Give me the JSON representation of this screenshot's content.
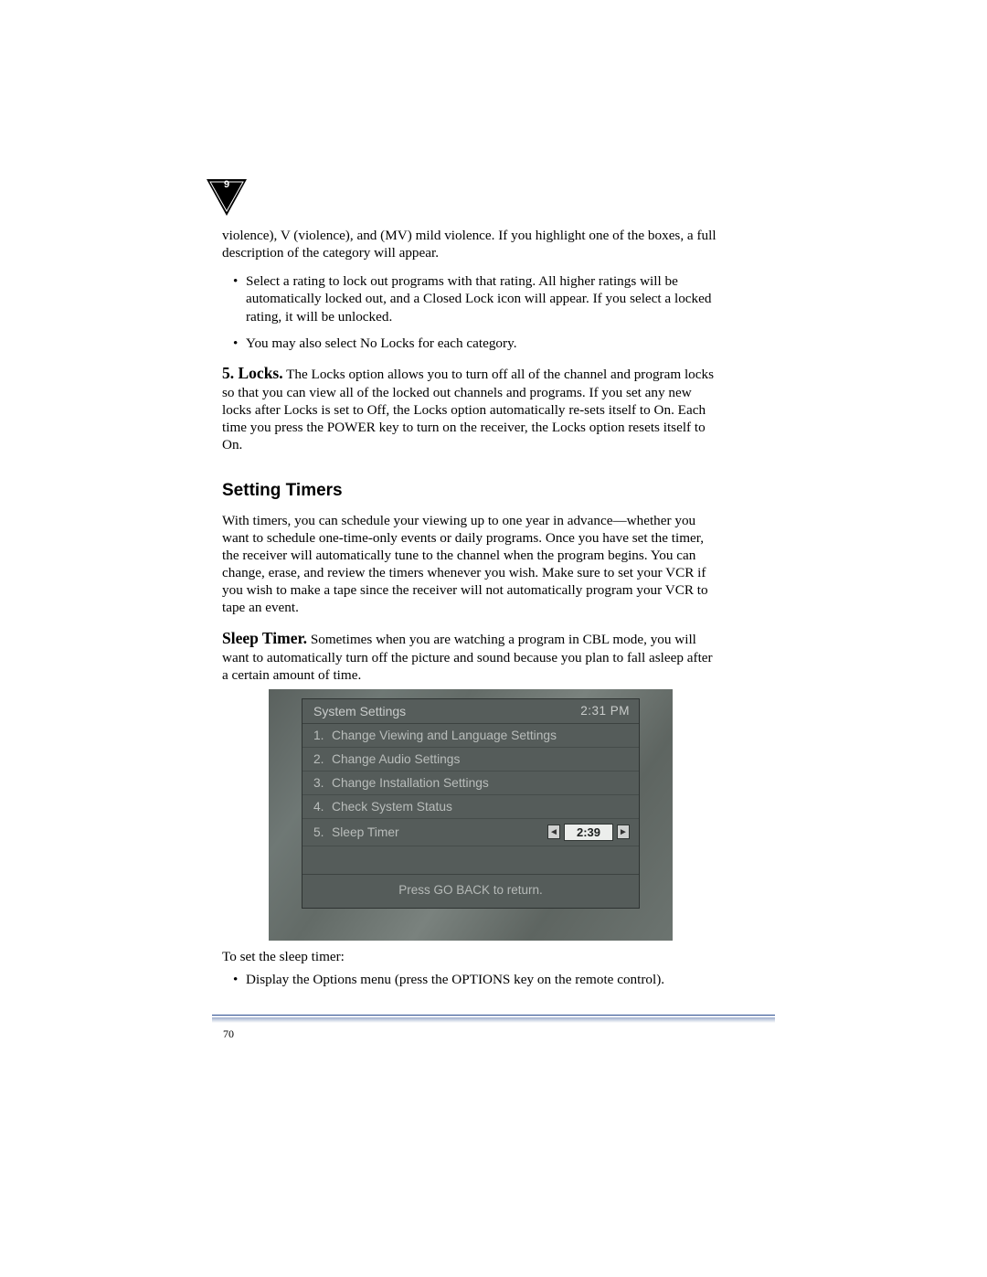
{
  "chapter_marker": "9",
  "page_number": "70",
  "intro_continued": "violence), V (violence), and (MV) mild violence. If you highlight one of the boxes, a full description of the category will appear.",
  "bullets_top": [
    "Select a rating to lock out programs with that rating. All higher ratings will be automatically locked out, and a Closed Lock icon will appear. If you select a locked rating, it will be unlocked.",
    "You may also select No Locks for each category."
  ],
  "locks": {
    "label": "5. Locks.",
    "text": " The Locks option allows you to turn off all of the channel and program locks so that you can view all of the locked out channels and programs. If you set any new locks after Locks is set to Off, the Locks option automatically re-sets itself to On. Each time you press the POWER key to turn on the receiver, the Locks option resets itself to On."
  },
  "heading_timers": "Setting Timers",
  "timers_para": "With timers, you can schedule your viewing up to one year in advance—whether you want to schedule one-time-only events or daily programs. Once you have set the timer, the receiver will automatically tune to the channel when the program begins. You can change, erase, and review the timers whenever you wish. Make sure to set your VCR if you wish to make a tape since the receiver will not automatically program your VCR to tape an event.",
  "sleep": {
    "label": "Sleep Timer.",
    "text": " Sometimes when you are watching a program in CBL mode, you will want to automatically turn off the picture and sound because you plan to fall asleep after a certain amount of time."
  },
  "osd": {
    "title": "System Settings",
    "clock": "2:31 PM",
    "rows": [
      {
        "num": "1.",
        "label": "Change Viewing and Language Settings"
      },
      {
        "num": "2.",
        "label": "Change Audio Settings"
      },
      {
        "num": "3.",
        "label": "Change Installation Settings"
      },
      {
        "num": "4.",
        "label": "Check System Status"
      },
      {
        "num": "5.",
        "label": "Sleep Timer",
        "value": "2:39"
      }
    ],
    "footer": "Press GO BACK to return."
  },
  "set_sleep_intro": "To set the sleep timer:",
  "bullets_bottom": [
    "Display the Options menu (press the OPTIONS key on the remote control)."
  ]
}
